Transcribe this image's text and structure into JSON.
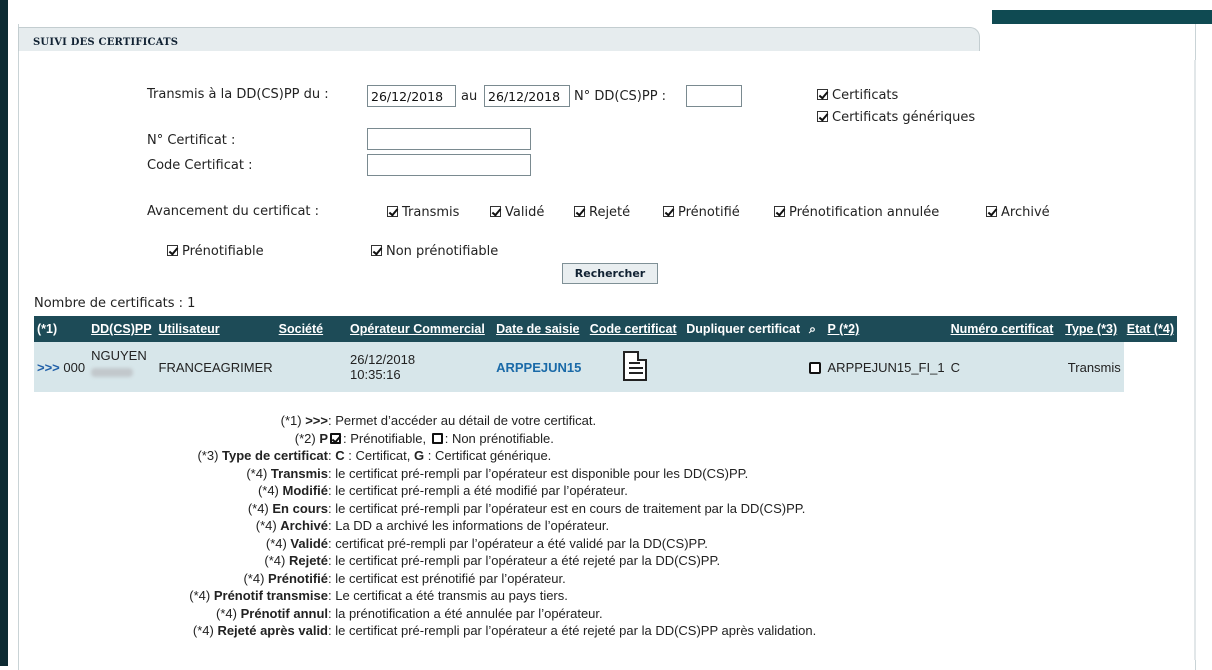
{
  "panel": {
    "title": "SUIVI DES CERTIFICATS"
  },
  "filters": {
    "transmis_label": "Transmis à la DD(CS)PP du :",
    "date_from": "26/12/2018",
    "au_label": "au",
    "date_to": "26/12/2018",
    "ddcspp_label": "N° DD(CS)PP :",
    "ddcspp_value": "",
    "num_cert_label": "N° Certificat :",
    "num_cert_value": "",
    "code_cert_label": "Code Certificat :",
    "code_cert_value": "",
    "type_checkboxes": [
      {
        "label": "Certificats",
        "checked": true
      },
      {
        "label": "Certificats génériques",
        "checked": true
      }
    ],
    "avancement_label": "Avancement du certificat :",
    "avancement": [
      {
        "label": "Transmis",
        "checked": true
      },
      {
        "label": "Validé",
        "checked": true
      },
      {
        "label": "Rejeté",
        "checked": true
      },
      {
        "label": "Prénotifié",
        "checked": true
      },
      {
        "label": "Prénotification annulée",
        "checked": true
      },
      {
        "label": "Archivé",
        "checked": true
      }
    ],
    "prenotif": [
      {
        "label": "Prénotifiable",
        "checked": true
      },
      {
        "label": "Non prénotifiable",
        "checked": true
      }
    ],
    "search_button": "Rechercher"
  },
  "results": {
    "count_label": "Nombre de certificats : 1",
    "columns": [
      "(*1)",
      "DD(CS)PP",
      "Utilisateur",
      "Société",
      "Opérateur Commercial",
      "Date de saisie",
      "Code certificat",
      "Dupliquer certificat",
      "",
      "P (*2)",
      "Numéro certificat",
      "Type (*3)",
      "Etat (*4)"
    ],
    "rows": [
      {
        "detail": ">>>",
        "ddcspp": "000",
        "utilisateur": "NGUYEN",
        "societe": "FRANCEAGRIMER",
        "operateur": "",
        "date": "26/12/2018",
        "time": "10:35:16",
        "code": "ARPPEJUN15",
        "numero": "ARPPEJUN15_FI_1",
        "type": "C",
        "etat": "Transmis",
        "prenotifiable": false
      }
    ]
  },
  "legend": [
    {
      "prefix": "(*1) ",
      "key": ">>>",
      "text": ": Permet d’accéder au détail de votre certificat."
    },
    {
      "prefix": "(*2) ",
      "key": "P",
      "text": ": Prénotifiable, ",
      "text2": ": Non prénotifiable."
    },
    {
      "prefix": "(*3) ",
      "key": "Type de certificat",
      "text": ": ",
      "c": "C",
      "c_text": " : Certificat, ",
      "g": "G",
      "g_text": " : Certificat générique."
    },
    {
      "prefix": "(*4) ",
      "key": "Transmis",
      "text": ": le certificat pré-rempli par l’opérateur est disponible pour les DD(CS)PP."
    },
    {
      "prefix": "(*4) ",
      "key": "Modifié",
      "text": ": le certificat pré-rempli a été modifié par l’opérateur."
    },
    {
      "prefix": "(*4) ",
      "key": "En cours",
      "text": ": le certificat pré-rempli par l’opérateur est en cours de traitement par la DD(CS)PP."
    },
    {
      "prefix": "(*4) ",
      "key": "Archivé",
      "text": ": La DD a archivé les informations de l’opérateur."
    },
    {
      "prefix": "(*4) ",
      "key": "Validé",
      "text": ": certificat pré-rempli par l’opérateur a été validé par la DD(CS)PP."
    },
    {
      "prefix": "(*4) ",
      "key": "Rejeté",
      "text": ": le certificat pré-rempli par l’opérateur a été rejeté par la DD(CS)PP."
    },
    {
      "prefix": "(*4) ",
      "key": "Prénotifié",
      "text": ": le certificat est prénotifié par l’opérateur."
    },
    {
      "prefix": "(*4) ",
      "key": "Prénotif transmise",
      "text": ": Le certificat a été transmis au pays tiers."
    },
    {
      "prefix": "(*4) ",
      "key": "Prénotif annul",
      "text": ": la prénotification a été annulée par l’opérateur."
    },
    {
      "prefix": "(*4) ",
      "key": "Rejeté après valid",
      "text": ": le certificat pré-rempli par l’opérateur a été rejeté par la DD(CS)PP après validation."
    }
  ]
}
